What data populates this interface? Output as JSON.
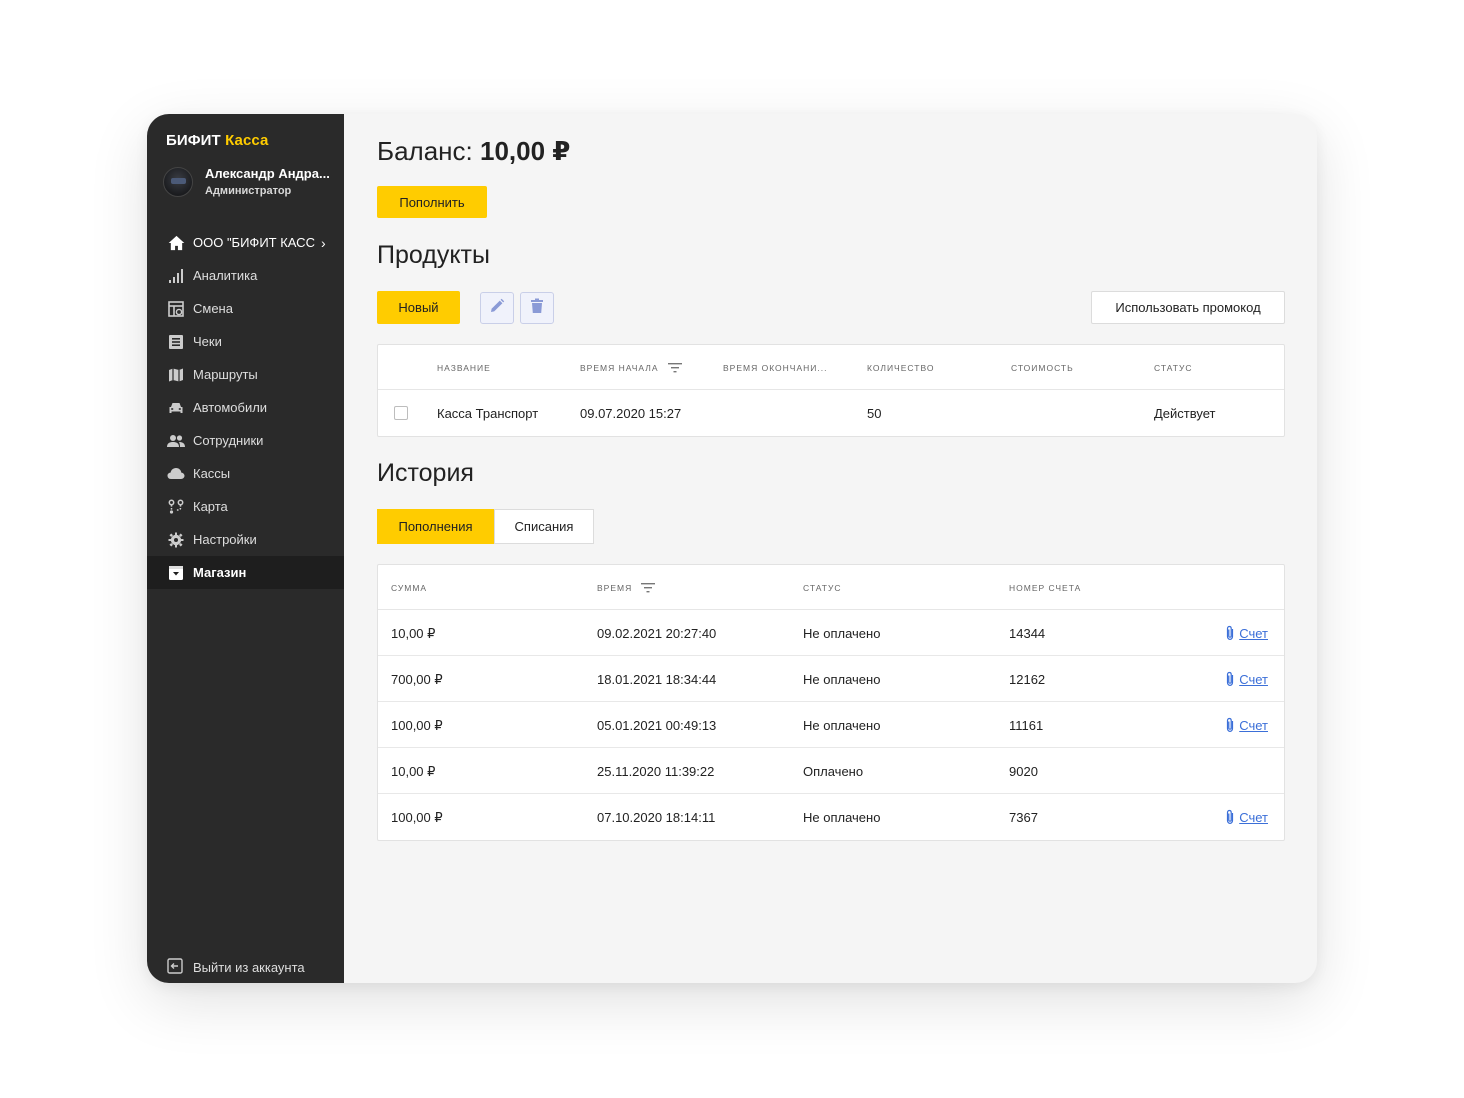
{
  "brand": {
    "name": "БИФИТ",
    "accent": "Касса"
  },
  "user": {
    "name": "Александр Андра...",
    "role": "Администратор"
  },
  "sidebar": {
    "org": "ООО \"БИФИТ КАСС",
    "items": [
      {
        "label": "Аналитика",
        "icon": "bar-chart-icon"
      },
      {
        "label": "Смена",
        "icon": "shift-icon"
      },
      {
        "label": "Чеки",
        "icon": "receipt-icon"
      },
      {
        "label": "Маршруты",
        "icon": "map-icon"
      },
      {
        "label": "Автомобили",
        "icon": "car-icon"
      },
      {
        "label": "Сотрудники",
        "icon": "people-icon"
      },
      {
        "label": "Кассы",
        "icon": "cloud-icon"
      },
      {
        "label": "Карта",
        "icon": "route-icon"
      },
      {
        "label": "Настройки",
        "icon": "gear-icon"
      },
      {
        "label": "Магазин",
        "icon": "store-icon"
      }
    ],
    "logout": "Выйти из аккаунта"
  },
  "balance": {
    "label": "Баланс:",
    "value": "10,00 ₽"
  },
  "buttons": {
    "topup": "Пополнить",
    "new": "Новый",
    "promo": "Использовать промокод"
  },
  "products": {
    "title": "Продукты",
    "columns": [
      "Название",
      "Время начала",
      "Время окончани...",
      "Количество",
      "Стоимость",
      "Статус"
    ],
    "rows": [
      {
        "name": "Касса Транспорт",
        "start": "09.07.2020 15:27",
        "end": "",
        "qty": "50",
        "cost": "",
        "status": "Действует"
      }
    ]
  },
  "history": {
    "title": "История",
    "tabs": [
      "Пополнения",
      "Списания"
    ],
    "columns": [
      "Сумма",
      "Время",
      "Статус",
      "Номер счета"
    ],
    "link_label": "Счет",
    "rows": [
      {
        "amount": "10,00 ₽",
        "time": "09.02.2021 20:27:40",
        "status": "Не оплачено",
        "number": "14344",
        "link": "Счет"
      },
      {
        "amount": "700,00 ₽",
        "time": "18.01.2021 18:34:44",
        "status": "Не оплачено",
        "number": "12162",
        "link": "Счет"
      },
      {
        "amount": "100,00 ₽",
        "time": "05.01.2021 00:49:13",
        "status": "Не оплачено",
        "number": "11161",
        "link": "Счет"
      },
      {
        "amount": "10,00 ₽",
        "time": "25.11.2020 11:39:22",
        "status": "Оплачено",
        "number": "9020",
        "link": ""
      },
      {
        "amount": "100,00 ₽",
        "time": "07.10.2020 18:14:11",
        "status": "Не оплачено",
        "number": "7367",
        "link": "Счет"
      }
    ]
  },
  "colors": {
    "accent": "#ffcc00",
    "sidebar": "#2a2a2a",
    "link": "#3b6fd8"
  }
}
